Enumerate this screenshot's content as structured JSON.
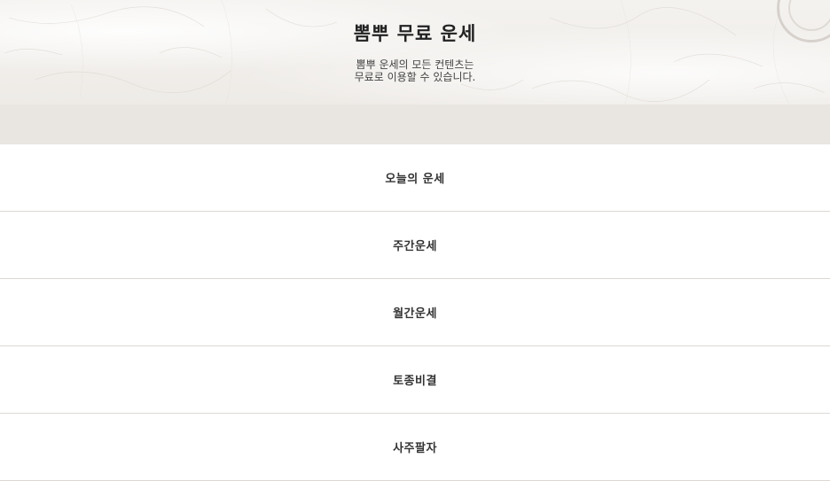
{
  "header": {
    "title": "뽐뿌 무료 운세",
    "subtitle_line1": "뽐뿌 운세의 모든 컨텐츠는",
    "subtitle_line2": "무료로 이용할 수 있습니다."
  },
  "menu": {
    "items": [
      {
        "label": "오늘의 운세"
      },
      {
        "label": "주간운세"
      },
      {
        "label": "월간운세"
      },
      {
        "label": "토종비결"
      },
      {
        "label": "사주팔자"
      }
    ]
  }
}
